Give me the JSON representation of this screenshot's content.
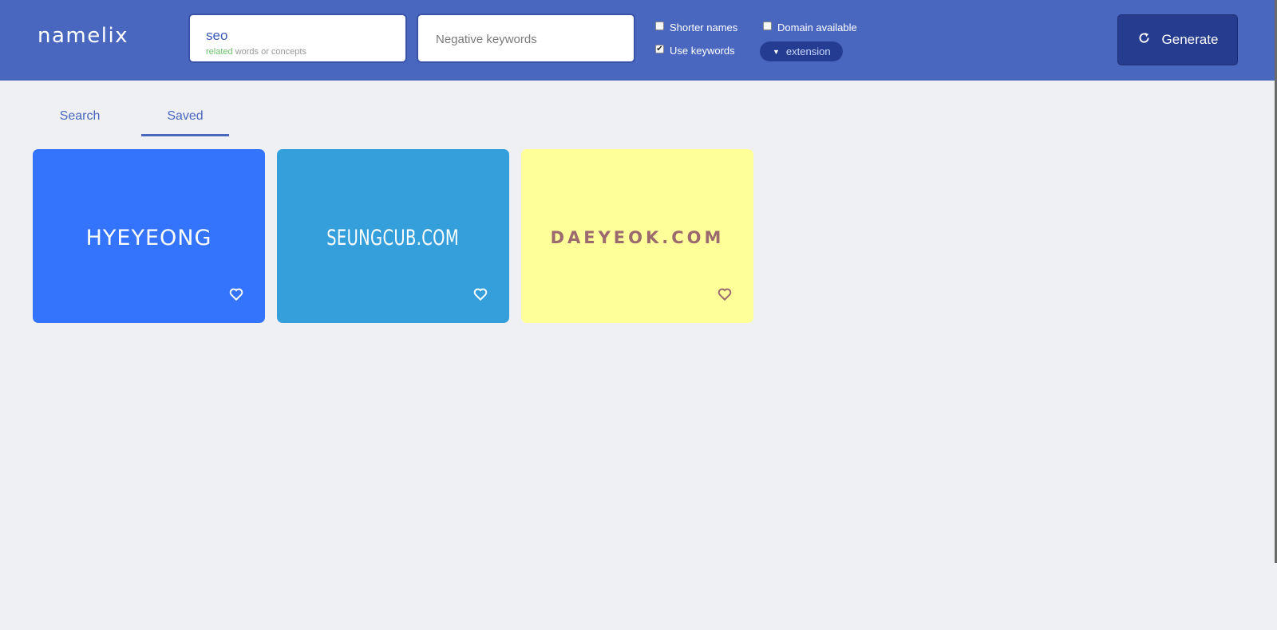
{
  "app": {
    "logo": "namelix"
  },
  "search": {
    "keyword_value": "seo",
    "keyword_hint_highlight": "related",
    "keyword_hint_rest": " words or concepts",
    "negative_placeholder": "Negative keywords"
  },
  "options": {
    "shorter_names": {
      "label": "Shorter names",
      "checked": false
    },
    "use_keywords": {
      "label": "Use keywords",
      "checked": true
    },
    "domain_available": {
      "label": "Domain available",
      "checked": false
    },
    "extension_label": "extension"
  },
  "generate_label": "Generate",
  "tabs": [
    {
      "label": "Search",
      "active": false
    },
    {
      "label": "Saved",
      "active": true
    }
  ],
  "cards": [
    {
      "name": "HYEYEONG",
      "bg": "#3474fc",
      "text_color": "#ffffff",
      "icon": "heart-outline-icon"
    },
    {
      "name": "SEUNGCUB.COM",
      "bg": "#359fdc",
      "text_color": "#ffffff",
      "icon": "heart-outline-icon"
    },
    {
      "name": "DAEYEOK.COM",
      "bg": "#ffff99",
      "text_color": "#9b6a6f",
      "icon": "heart-outline-icon"
    }
  ],
  "colors": {
    "header": "#4a67c0",
    "page_bg": "#eef0f4",
    "generate_bg": "#263c8f"
  }
}
